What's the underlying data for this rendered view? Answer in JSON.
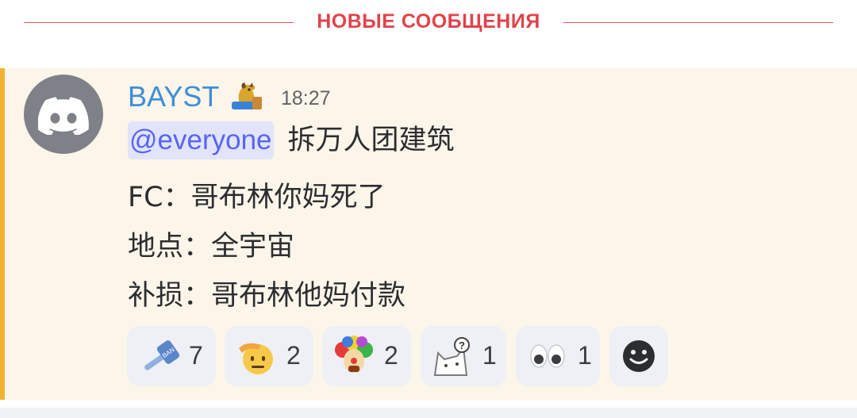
{
  "divider": {
    "label": "НОВЫЕ СООБЩЕНИЯ",
    "color": "#e2424a"
  },
  "message": {
    "author": "BAYST",
    "author_color": "#3e8fd6",
    "author_badge_icon": "horse-badge-icon",
    "avatar_icon": "discord-logo-icon",
    "timestamp": "18:27",
    "mention": "@everyone",
    "lines": [
      "拆万人团建筑",
      "FC：哥布林你妈死了",
      "地点：全宇宙",
      "补损：哥布林他妈付款"
    ]
  },
  "reactions": [
    {
      "icon": "hammer-emoji-icon",
      "count": "7"
    },
    {
      "icon": "salute-face-emoji-icon",
      "count": "2"
    },
    {
      "icon": "clown-emoji-icon",
      "count": "2"
    },
    {
      "icon": "confused-cat-emoji-icon",
      "count": "1"
    },
    {
      "icon": "eyes-emoji-icon",
      "count": "1"
    }
  ],
  "add_reaction_icon": "add-reaction-smiley-icon"
}
